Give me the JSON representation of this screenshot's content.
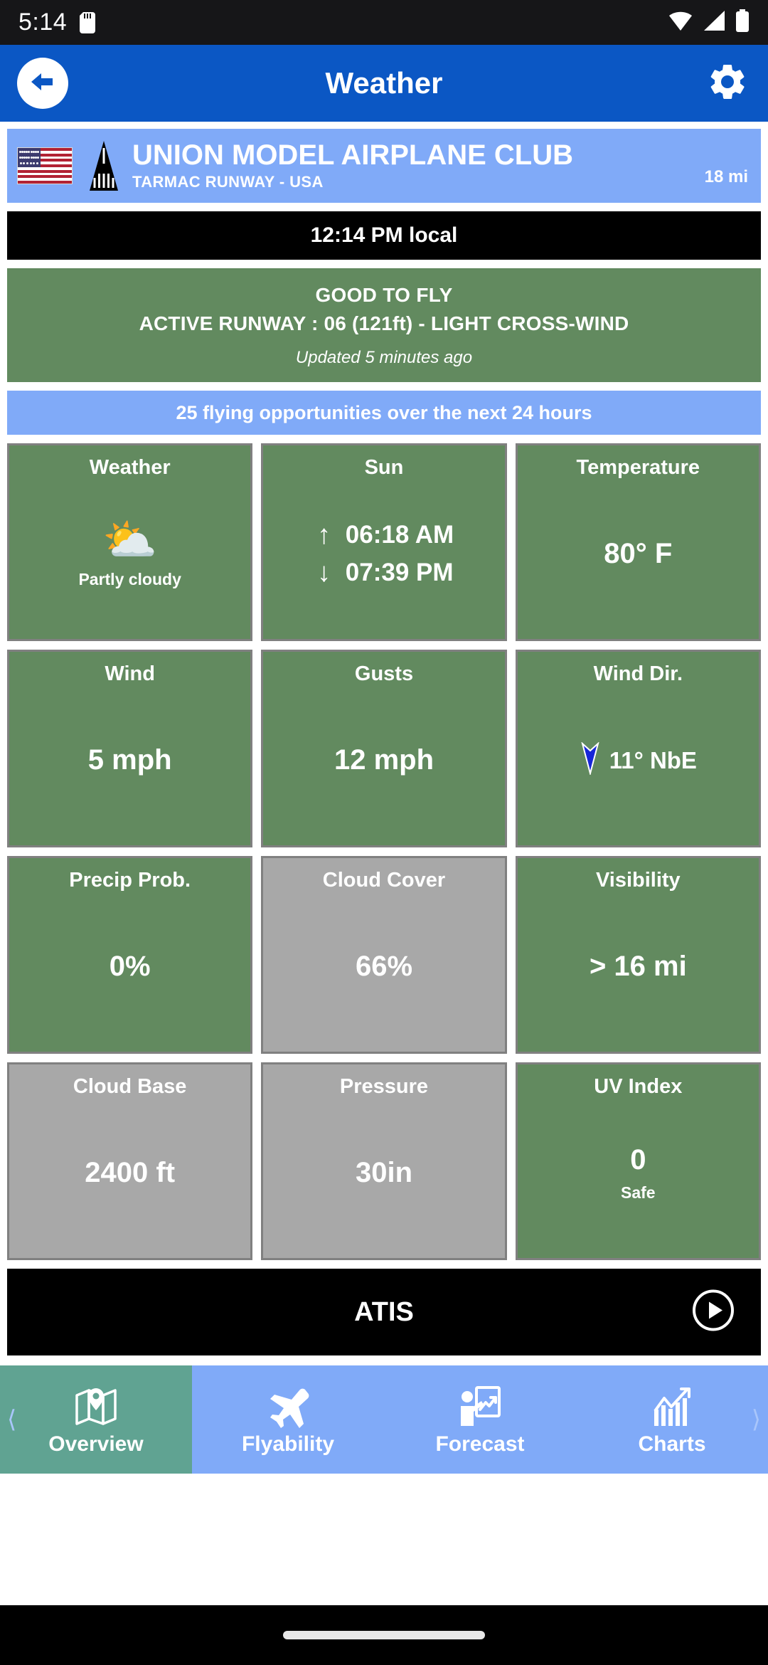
{
  "status_bar": {
    "time": "5:14",
    "icons": [
      "sd-card-icon",
      "wifi-icon",
      "signal-icon",
      "battery-icon"
    ]
  },
  "app_bar": {
    "title": "Weather",
    "back_icon": "back-arrow-icon",
    "settings_icon": "gear-icon",
    "background_color": "#0b57c4"
  },
  "club": {
    "name": "UNION MODEL AIRPLANE CLUB",
    "subtitle": "TARMAC RUNWAY - USA",
    "distance": "18 mi",
    "flag_icon": "usa-flag-icon",
    "runway_icon": "runway-icon",
    "background_color": "#80aaf8"
  },
  "local_time": "12:14 PM local",
  "status": {
    "headline": "GOOD TO FLY",
    "detail": "ACTIVE RUNWAY : 06 (121ft) - LIGHT CROSS-WIND",
    "updated": "Updated 5 minutes ago",
    "background_color": "#628a5f"
  },
  "opportunities": "25 flying opportunities over the next 24 hours",
  "tiles": [
    [
      {
        "title": "Weather",
        "icon": "partly-cloudy-icon",
        "value": "",
        "sub": "Partly cloudy",
        "state": "green"
      },
      {
        "title": "Sun",
        "sunrise": "06:18 AM",
        "sunset": "07:39 PM",
        "sunrise_icon": "arrow-up-icon",
        "sunset_icon": "arrow-down-icon",
        "state": "green"
      },
      {
        "title": "Temperature",
        "value": "80° F",
        "state": "green"
      }
    ],
    [
      {
        "title": "Wind",
        "value": "5 mph",
        "state": "green"
      },
      {
        "title": "Gusts",
        "value": "12 mph",
        "state": "green"
      },
      {
        "title": "Wind Dir.",
        "value": "11° NbE",
        "icon": "wind-direction-arrow-icon",
        "state": "green"
      }
    ],
    [
      {
        "title": "Precip Prob.",
        "value": "0%",
        "state": "green"
      },
      {
        "title": "Cloud Cover",
        "value": "66%",
        "state": "gray"
      },
      {
        "title": "Visibility",
        "value": "> 16 mi",
        "state": "green"
      }
    ],
    [
      {
        "title": "Cloud Base",
        "value": "2400 ft",
        "state": "gray"
      },
      {
        "title": "Pressure",
        "value": "30in",
        "state": "gray"
      },
      {
        "title": "UV Index",
        "value": "0",
        "sub": "Safe",
        "state": "green"
      }
    ]
  ],
  "atis": {
    "label": "ATIS",
    "play_icon": "play-icon"
  },
  "bottom_nav": {
    "items": [
      {
        "label": "Overview",
        "icon": "map-pin-icon",
        "active": true
      },
      {
        "label": "Flyability",
        "icon": "airplane-icon",
        "active": false
      },
      {
        "label": "Forecast",
        "icon": "presenter-icon",
        "active": false
      },
      {
        "label": "Charts",
        "icon": "bar-chart-icon",
        "active": false
      }
    ],
    "prev_icon": "chevron-left-icon",
    "next_icon": "chevron-right-icon",
    "background_color": "#80aaf8",
    "active_color": "#60a392"
  },
  "colors": {
    "green_ok": "#628a5f",
    "gray_neutral": "#a8a8a8",
    "brand_blue": "#0b57c4",
    "light_blue": "#80aaf8"
  }
}
